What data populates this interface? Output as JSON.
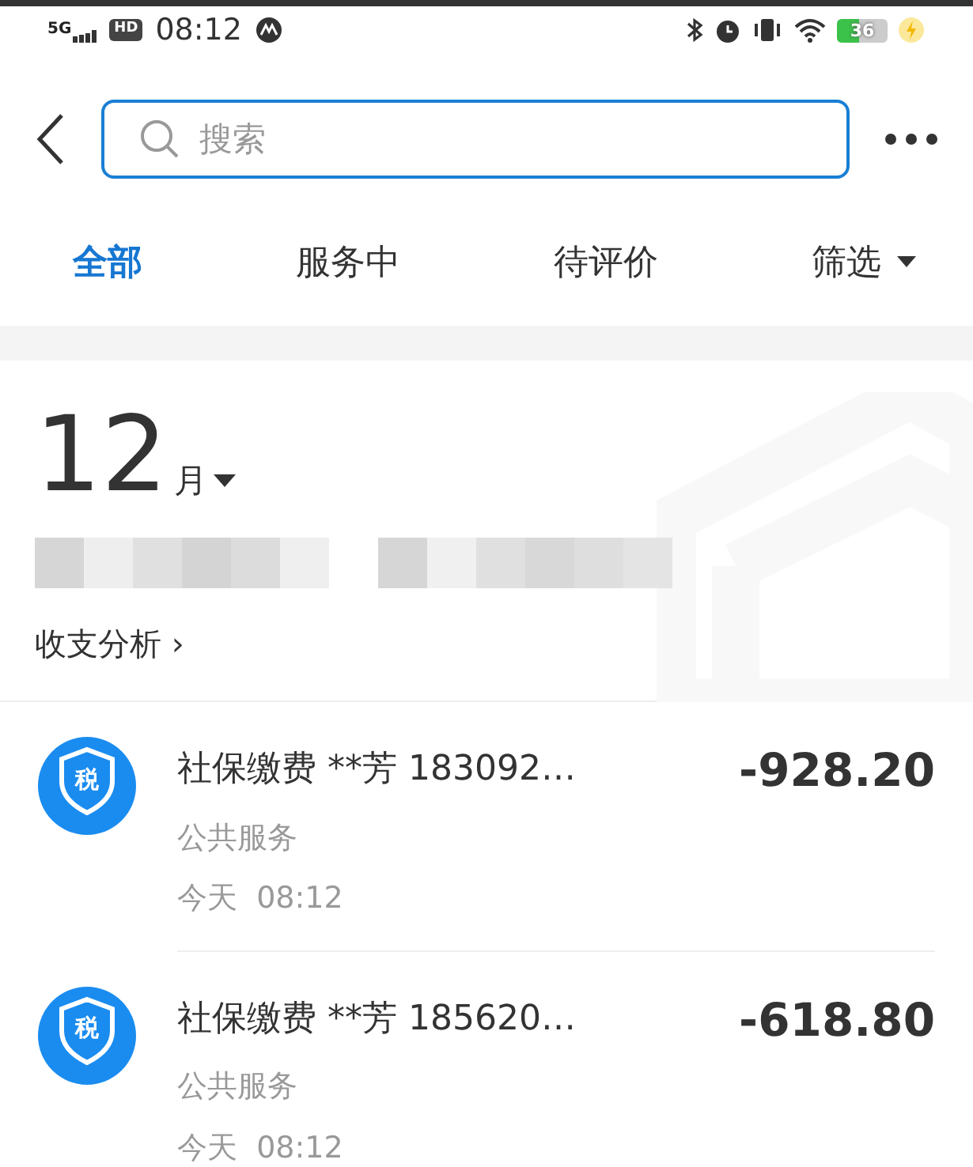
{
  "status_bar": {
    "network": "5G",
    "hd": "HD",
    "time": "08:12",
    "battery": "36"
  },
  "search": {
    "placeholder": "搜索"
  },
  "tabs": [
    {
      "label": "全部",
      "selected": true
    },
    {
      "label": "服务中",
      "selected": false
    },
    {
      "label": "待评价",
      "selected": false
    },
    {
      "label": "筛选",
      "selected": false
    }
  ],
  "summary": {
    "month": "12",
    "month_unit": "月",
    "analysis_link": "收支分析 ›"
  },
  "transactions": [
    {
      "badge": "税",
      "title": "社保缴费",
      "payer": "**芳",
      "account": "183092…",
      "amount": "-928.20",
      "category": "公共服务",
      "date": "今天",
      "time": "08:12"
    },
    {
      "badge": "税",
      "title": "社保缴费",
      "payer": "**芳",
      "account": "185620…",
      "amount": "-618.80",
      "category": "公共服务",
      "date": "今天",
      "time": "08:12"
    }
  ]
}
